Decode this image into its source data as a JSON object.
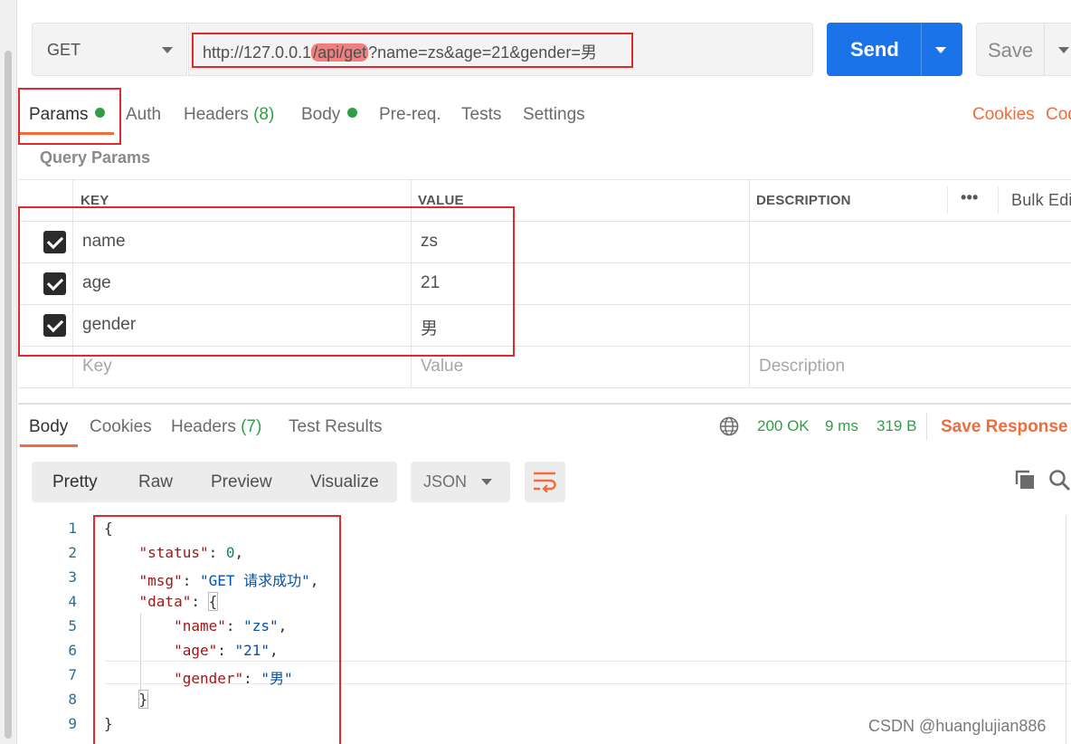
{
  "request": {
    "method": "GET",
    "url_prefix": "http://127.0.0.1",
    "url_highlight": "/api/get",
    "url_query": "?name=zs&age=21&gender=男",
    "send_label": "Send",
    "save_label": "Save"
  },
  "tabs": {
    "params": "Params",
    "auth": "Auth",
    "headers": "Headers",
    "headers_count": "(8)",
    "body": "Body",
    "prereq": "Pre-req.",
    "tests": "Tests",
    "settings": "Settings",
    "cookies": "Cookies",
    "code": "Cod"
  },
  "query_params": {
    "title": "Query Params",
    "columns": {
      "key": "KEY",
      "value": "VALUE",
      "description": "DESCRIPTION"
    },
    "more": "•••",
    "bulk_edit": "Bulk Edi",
    "rows": [
      {
        "key": "name",
        "value": "zs",
        "checked": true
      },
      {
        "key": "age",
        "value": "21",
        "checked": true
      },
      {
        "key": "gender",
        "value": "男",
        "checked": true
      }
    ],
    "placeholder": {
      "key": "Key",
      "value": "Value",
      "description": "Description"
    }
  },
  "response": {
    "tabs": {
      "body": "Body",
      "cookies": "Cookies",
      "headers": "Headers",
      "headers_count": "(7)",
      "test_results": "Test Results"
    },
    "status": "200 OK",
    "time": "9 ms",
    "size": "319 B",
    "save_response": "Save Response",
    "views": {
      "pretty": "Pretty",
      "raw": "Raw",
      "preview": "Preview",
      "visualize": "Visualize"
    },
    "format": "JSON",
    "line_numbers": [
      "1",
      "2",
      "3",
      "4",
      "5",
      "6",
      "7",
      "8",
      "9"
    ],
    "json": {
      "status_key": "\"status\"",
      "status_val": "0",
      "msg_key": "\"msg\"",
      "msg_val": "\"GET 请求成功\"",
      "data_key": "\"data\"",
      "name_key": "\"name\"",
      "name_val": "\"zs\"",
      "age_key": "\"age\"",
      "age_val": "\"21\"",
      "gender_key": "\"gender\"",
      "gender_val": "\"男\""
    }
  },
  "watermark": "CSDN @huanglujian886",
  "colors": {
    "accent": "#f26b3a",
    "send": "#1a73e8",
    "ok": "#2f9e47",
    "annotation": "#e0282e"
  }
}
